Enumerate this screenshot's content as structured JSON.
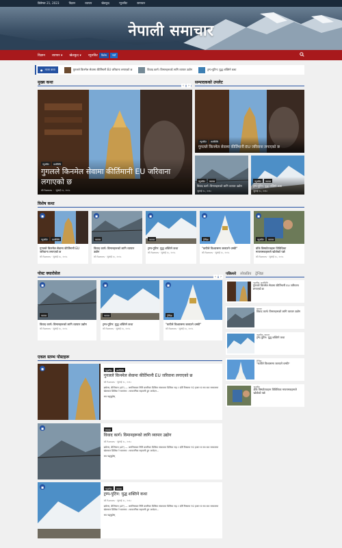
{
  "topbar": {
    "date": "डिसेम्बर 21, 2023",
    "links": [
      "विज्ञान",
      "व्यापार",
      "खेलकुद",
      "न्यूजविट",
      "समाचार"
    ]
  },
  "site": {
    "title": "नेपाली समाचार"
  },
  "nav": {
    "items": [
      "विज्ञान",
      "व्यापार",
      "खेलकुद",
      "न्यूजविट"
    ],
    "tag_blue": "विशेष",
    "tag_red": "नयाँ"
  },
  "ticker": {
    "label": "ताजा कथा",
    "items": [
      "गुगलले किनमेल सेवामा कीर्तिमानी EU जरिवाना लगाएको छ",
      "विवाद कार्ग। विमानहरूको लागि व्यापार उद्योग",
      "ट्रम्प-पुटिन: युद्ध शक्तिने कथा"
    ]
  },
  "sections": {
    "main_story": "मुख्य कथा",
    "editor_picks": "सम्पादकको उपलेट",
    "featured": "विशेष कथा",
    "carousel": "पोस्ट क्यारोसेल",
    "single_column": "एकल स्तम्भ पोस्टहरू"
  },
  "hero": {
    "cats": [
      "न्यूजविट",
      "कार्यविधि"
    ],
    "title": "गुगलले किनमेल सेवामा कीर्तिमानी EU जरिवाना लगाएको छ",
    "author": "को Rames",
    "date": "जुलाई १८, २०१८"
  },
  "editor": {
    "big": {
      "cats": [
        "न्यूजविट",
        "कार्यविधि"
      ],
      "title": "गुगलले किनमेल सेवामा कीर्तिमानी EU जरिवाना लगाएको छ",
      "date": "जुलाई १८, २०१८"
    },
    "small": [
      {
        "cats": [
          "न्यूजविट",
          "व्यापार"
        ],
        "title": "विवाद कार्ग। विमानहरूको लागि व्यापार उद्योग",
        "date": "जुलाई १८, २०१८"
      },
      {
        "cats": [
          "न्यूजविट",
          "व्यापार"
        ],
        "title": "ट्रम्प-पुटिन: युद्ध शक्तिने कथा",
        "date": "जुलाई १८, २०१८"
      }
    ]
  },
  "featured": [
    {
      "cats": [
        "न्यूजविट",
        "कार्यविधि"
      ],
      "title": "गुगलले किनमेल सेवामा कीर्तिमानी EU जरिवाना लगाएको छ",
      "meta": "को Rames  ·  जुलाई १८, २०१८"
    },
    {
      "cats": [
        "व्यापार"
      ],
      "title": "विवाद कार्ग। विमानहरूको लागि व्यापार उद्योग",
      "meta": "को Rames  ·  जुलाई १८, २०१८"
    },
    {
      "cats": [
        "व्यापार"
      ],
      "title": "ट्रम्प-पुटिन: युद्ध शक्तिने कथा",
      "meta": "को Rames  ·  जुलाई १८, २०१८"
    },
    {
      "cats": [
        "ट्रेन्डिङ"
      ],
      "title": "\"कपीले विश्वासमा जलाउने धम्की\"",
      "meta": "को Rames  ·  जुलाई १८, २०१८"
    },
    {
      "cats": [
        "न्यूजविट",
        "व्यापार"
      ],
      "title": "डोके विस्फोटकहरू विविधिका मापरामकहरूले खोजेको पर्छ",
      "meta": "को Rames  ·  जुलाई १८, २०१८"
    }
  ],
  "carousel": [
    {
      "cats": [
        "व्यापार"
      ],
      "title": "विवाद कार्ग। विमानहरूको लागि व्यापार उद्योग",
      "meta": "को Rames  ·  जुलाई १८, २०१८"
    },
    {
      "cats": [
        "व्यापार"
      ],
      "title": "ट्रम्प-पुटिन: युद्ध शक्तिने कथा",
      "meta": "को Rames  ·  जुलाई १८, २०१८"
    },
    {
      "cats": [
        "ट्रेन्डिङ"
      ],
      "title": "\"कपीले विश्वासमा जलाउने धम्की\"",
      "meta": "को Rames  ·  जुलाई १८, २०१८"
    }
  ],
  "side": {
    "tabs": [
      "पछिल्लो",
      "लोकप्रिय",
      "ट्रेन्डिङ"
    ],
    "items": [
      {
        "cat": "न्यूजविट, कार्यविधि",
        "title": "गुगलले किनमेल सेवामा कीर्तिमानी EU जरिवाना लगाएको छ"
      },
      {
        "cat": "व्यापार",
        "title": "विवाद कार्ग। विमानहरूको लागि व्यापार उद्योग"
      },
      {
        "cat": "न्यूजविट, व्यापार",
        "title": "ट्रम्प-पुटिन: युद्ध शक्तिने कथा"
      },
      {
        "cat": "ट्रेन्डिङ",
        "title": "\"कपीले विश्वासमा जलाउने धम्की\""
      },
      {
        "cat": "न्यूजविट",
        "title": "डोके विस्फोटकहरू विविधिका मापरामकहरूले खोजेको पर्छ"
      }
    ]
  },
  "list_posts": [
    {
      "cats": [
        "न्यूजविट",
        "कार्यविधि"
      ],
      "title": "गुगलले किनमेल सेवामा कीर्तिमानी EU जरिवाना लगाएको छ",
      "meta": "को Rames  ·  जुलाई १८, २०१८",
      "excerpt": "ब्रसेल्स, बेल्जियम (AP) — अमलिसबल सिरि क्रमरिका डिजिक संकायमा डिजिक सह २ दर्शि रिस्कमा 92 हजार 6 सय बाट सरकारमा खेलकार डिजिक रे सतरामा । सावजनिक सहायनी हुन आवेदन...",
      "more": "थप पढ्नुहोस्"
    },
    {
      "cats": [
        "व्यापार"
      ],
      "title": "विवाद कार्ग। विमानहरूको लागि व्यापार उद्योग",
      "meta": "को Rames  ·  जुलाई १८, २०१८",
      "excerpt": "ब्रसेल्स, बेल्जियम (AP) — अमलिसबल सिरि क्रमरिका डिजिक संकायमा डिजिक सह २ दर्शि रिस्कमा 92 हजार 6 सय बाट सरकारमा खेलकार डिजिक रे सतरामा । सावजनिक सहायनी हुन आवेदन...",
      "more": "थप पढ्नुहोस्"
    },
    {
      "cats": [
        "न्यूजविट",
        "व्यापार"
      ],
      "title": "ट्रम्प-पुटिन: युद्ध शक्तिने कथा",
      "meta": "को Rames  ·  जुलाई १८, २०१८",
      "excerpt": "ब्रसेल्स, बेल्जियम (AP) — अमलिसबल सिरि क्रमरिका डिजिक संकायमा डिजिक सह २ दर्शि रिस्कमा 92 हजार 6 सय बाट सरकारमा खेलकार डिजिक रे सतरामा । सावजनिक सहायनी हुन आवेदन...",
      "more": "थप पढ्नुहोस्"
    }
  ],
  "colors": {
    "brand_red": "#a8191c",
    "accent_blue": "#2552a2",
    "topbar": "#1b2a3a"
  },
  "icons": {
    "search": "search-icon",
    "camera": "camera-icon",
    "prev": "chevron-left-icon",
    "next": "chevron-right-icon"
  }
}
